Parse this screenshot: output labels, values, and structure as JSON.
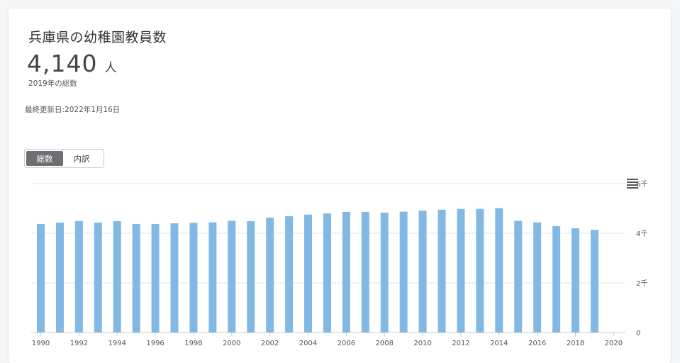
{
  "header": {
    "title": "兵庫県の幼稚園教員数",
    "value": "4,140",
    "unit": "人",
    "subnote": "2019年の総数",
    "updated": "最終更新日:2022年1月16日"
  },
  "toggle": {
    "items": [
      {
        "label": "総数",
        "active": true
      },
      {
        "label": "内訳",
        "active": false
      }
    ]
  },
  "colors": {
    "bar": "#82b9e4",
    "grid": "#e6e6e6"
  },
  "chart_data": {
    "type": "bar",
    "title": "",
    "xlabel": "",
    "ylabel": "",
    "x": [
      1990,
      1991,
      1992,
      1993,
      1994,
      1995,
      1996,
      1997,
      1998,
      1999,
      2000,
      2001,
      2002,
      2003,
      2004,
      2005,
      2006,
      2007,
      2008,
      2009,
      2010,
      2011,
      2012,
      2013,
      2014,
      2015,
      2016,
      2017,
      2018,
      2019
    ],
    "values": [
      4370,
      4430,
      4490,
      4430,
      4490,
      4370,
      4370,
      4400,
      4420,
      4440,
      4500,
      4490,
      4630,
      4690,
      4750,
      4800,
      4860,
      4860,
      4830,
      4870,
      4910,
      4950,
      4980,
      4980,
      5010,
      4500,
      4440,
      4290,
      4200,
      4140
    ],
    "x_tick_labels": [
      "1990",
      "1992",
      "1994",
      "1996",
      "1998",
      "2000",
      "2002",
      "2004",
      "2006",
      "2008",
      "2010",
      "2012",
      "2014",
      "2016",
      "2018",
      "2020"
    ],
    "y_tick_labels": [
      "0",
      "2千",
      "4千",
      "6千"
    ],
    "ylim": [
      0,
      6000
    ],
    "xlim": [
      1990,
      2020
    ],
    "y_axis_side": "right",
    "grid": true,
    "legend": false
  }
}
